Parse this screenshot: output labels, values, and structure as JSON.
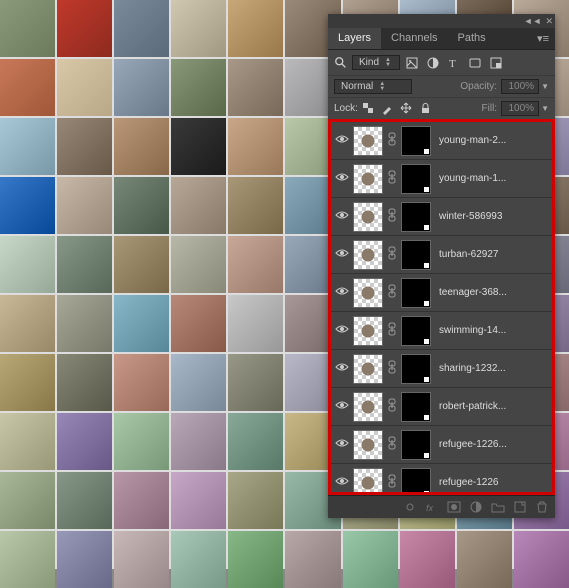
{
  "tabs": {
    "layers": "Layers",
    "channels": "Channels",
    "paths": "Paths"
  },
  "filter": {
    "kind": "Kind"
  },
  "blend": {
    "mode": "Normal",
    "opacity_label": "Opacity:",
    "opacity_value": "100%"
  },
  "lock": {
    "label": "Lock:",
    "fill_label": "Fill:",
    "fill_value": "100%"
  },
  "layers": [
    {
      "name": "young-man-2..."
    },
    {
      "name": "young-man-1..."
    },
    {
      "name": "winter-586993"
    },
    {
      "name": "turban-62927"
    },
    {
      "name": "teenager-368..."
    },
    {
      "name": "swimming-14..."
    },
    {
      "name": "sharing-1232..."
    },
    {
      "name": "robert-patrick..."
    },
    {
      "name": "refugee-1226..."
    },
    {
      "name": "refugee-1226"
    }
  ],
  "bg_colors": [
    [
      "#8a9a7a",
      "#6a7a5a"
    ],
    [
      "#c0392b",
      "#8e2a1f"
    ],
    [
      "#7a8a9a",
      "#5a6a7a"
    ],
    [
      "#d0c8b0",
      "#a09880"
    ],
    [
      "#c8a878",
      "#987848"
    ],
    [
      "#9a8a7a",
      "#6a5a4a"
    ],
    [
      "#b0a090",
      "#807060"
    ],
    [
      "#aabbcc",
      "#778899"
    ],
    [
      "#7a6a5a",
      "#4a3a2a"
    ],
    [
      "#baaa9a",
      "#8a7a6a"
    ],
    [
      "#c87858",
      "#a05838"
    ],
    [
      "#d8c8a8",
      "#b8a888"
    ],
    [
      "#98a8b8",
      "#687888"
    ],
    [
      "#889878",
      "#586848"
    ],
    [
      "#a89888",
      "#786858"
    ],
    [
      "#bababc",
      "#8a8a8c"
    ],
    [
      "#d0b090",
      "#a08060"
    ],
    [
      "#788868",
      "#485838"
    ],
    [
      "#8898a8",
      "#586878"
    ],
    [
      "#c8b8a8",
      "#988878"
    ],
    [
      "#a8c8d8",
      "#7898a8"
    ],
    [
      "#988878",
      "#685848"
    ],
    [
      "#b89878",
      "#886848"
    ],
    [
      "#3a3a3a",
      "#1a1a1a"
    ],
    [
      "#c8a888",
      "#987858"
    ],
    [
      "#b8c8a8",
      "#889878"
    ],
    [
      "#9888a8",
      "#685878"
    ],
    [
      "#c8bab0",
      "#988a80"
    ],
    [
      "#8ab8c8",
      "#5a8898"
    ],
    [
      "#b0a8c8",
      "#807898"
    ],
    [
      "#3878c8",
      "#084898"
    ],
    [
      "#c8b8a8",
      "#988878"
    ],
    [
      "#788878",
      "#485848"
    ],
    [
      "#b8a898",
      "#887868"
    ],
    [
      "#a89878",
      "#786848"
    ],
    [
      "#8aaabb",
      "#5a7a8b"
    ],
    [
      "#c8c8b8",
      "#989888"
    ],
    [
      "#b89888",
      "#886858"
    ],
    [
      "#a8b8c8",
      "#788898"
    ],
    [
      "#988878",
      "#685848"
    ],
    [
      "#c8d8c8",
      "#98a898"
    ],
    [
      "#889888",
      "#586858"
    ],
    [
      "#a89878",
      "#786848"
    ],
    [
      "#b8b8a8",
      "#888878"
    ],
    [
      "#c8a898",
      "#987868"
    ],
    [
      "#98a8b8",
      "#687888"
    ],
    [
      "#8898a8",
      "#586878"
    ],
    [
      "#b8a888",
      "#887858"
    ],
    [
      "#a8b8a8",
      "#788878"
    ],
    [
      "#9898a8",
      "#686878"
    ],
    [
      "#c8b898",
      "#988868"
    ],
    [
      "#a8a898",
      "#787868"
    ],
    [
      "#88b8c8",
      "#588898"
    ],
    [
      "#b88878",
      "#885848"
    ],
    [
      "#c8c8c8",
      "#989898"
    ],
    [
      "#a89898",
      "#786868"
    ],
    [
      "#b8a898",
      "#887868"
    ],
    [
      "#98b898",
      "#688868"
    ],
    [
      "#c8b8a8",
      "#988878"
    ],
    [
      "#a898b8",
      "#786888"
    ],
    [
      "#b8a878",
      "#887848"
    ],
    [
      "#888878",
      "#585848"
    ],
    [
      "#c89888",
      "#986858"
    ],
    [
      "#a8b8c8",
      "#788898"
    ],
    [
      "#989888",
      "#686858"
    ],
    [
      "#b8b8c8",
      "#888898"
    ],
    [
      "#c8a8a8",
      "#987878"
    ],
    [
      "#8898b8",
      "#586888"
    ],
    [
      "#a8a8b8",
      "#787888"
    ],
    [
      "#b89898",
      "#886868"
    ],
    [
      "#c8c8a8",
      "#989878"
    ],
    [
      "#9888b8",
      "#685888"
    ],
    [
      "#a8c8a8",
      "#789878"
    ],
    [
      "#b8a8b8",
      "#887888"
    ],
    [
      "#88a898",
      "#587868"
    ],
    [
      "#c8b888",
      "#988858"
    ],
    [
      "#a898a8",
      "#786878"
    ],
    [
      "#b8c8c8",
      "#889898"
    ],
    [
      "#98a888",
      "#687858"
    ],
    [
      "#c898b8",
      "#986888"
    ],
    [
      "#a8b898",
      "#788868"
    ],
    [
      "#889888",
      "#586858"
    ],
    [
      "#b898a8",
      "#886878"
    ],
    [
      "#c8a8c8",
      "#987898"
    ],
    [
      "#a8a888",
      "#787858"
    ],
    [
      "#98b8a8",
      "#688878"
    ],
    [
      "#b8b898",
      "#888868"
    ],
    [
      "#c8c898",
      "#989868"
    ],
    [
      "#88a8b8",
      "#587888"
    ],
    [
      "#a888b8",
      "#785888"
    ],
    [
      "#b8c8a8",
      "#889878"
    ],
    [
      "#9898b8",
      "#686888"
    ],
    [
      "#c8b8b8",
      "#988888"
    ],
    [
      "#a8c8b8",
      "#789888"
    ],
    [
      "#88b888",
      "#588858"
    ],
    [
      "#b8a8a8",
      "#887878"
    ],
    [
      "#98c8a8",
      "#689878"
    ],
    [
      "#c888a8",
      "#985878"
    ],
    [
      "#a89888",
      "#786858"
    ],
    [
      "#b888b8",
      "#885888"
    ]
  ]
}
